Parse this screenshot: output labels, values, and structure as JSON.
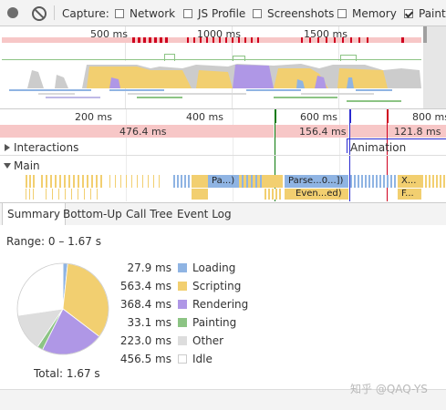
{
  "toolbar": {
    "capture_label": "Capture:",
    "checkboxes": [
      {
        "label": "Network",
        "checked": false
      },
      {
        "label": "JS Profile",
        "checked": false
      },
      {
        "label": "Screenshots",
        "checked": false
      },
      {
        "label": "Memory",
        "checked": false
      },
      {
        "label": "Paint",
        "checked": true
      }
    ]
  },
  "overview": {
    "ticks": [
      "500 ms",
      "1000 ms",
      "1500 ms"
    ]
  },
  "flamechart": {
    "ticks": [
      "200 ms",
      "400 ms",
      "600 ms",
      "800 ms"
    ],
    "frames": [
      "476.4 ms",
      "156.4 ms",
      "121.8 ms"
    ],
    "interactions_label": "Interactions",
    "animation_label": "Animation",
    "main_label": "Main",
    "events": [
      "Pa...)",
      "Parse...0...])",
      "Even...ed)",
      "X...",
      "F..."
    ]
  },
  "tabs": [
    "Summary",
    "Bottom-Up",
    "Call Tree",
    "Event Log"
  ],
  "summary": {
    "range": "Range: 0 – 1.67 s",
    "total": "Total: 1.67 s",
    "categories": [
      {
        "value": "27.9 ms",
        "label": "Loading",
        "color": "#8fb4e3"
      },
      {
        "value": "563.4 ms",
        "label": "Scripting",
        "color": "#f2cf70"
      },
      {
        "value": "368.4 ms",
        "label": "Rendering",
        "color": "#af97e6"
      },
      {
        "value": "33.1 ms",
        "label": "Painting",
        "color": "#8cc484"
      },
      {
        "value": "223.0 ms",
        "label": "Other",
        "color": "#dddddd"
      },
      {
        "value": "456.5 ms",
        "label": "Idle",
        "color": "#ffffff"
      }
    ]
  },
  "watermark": "知乎 @QAQ-YS"
}
